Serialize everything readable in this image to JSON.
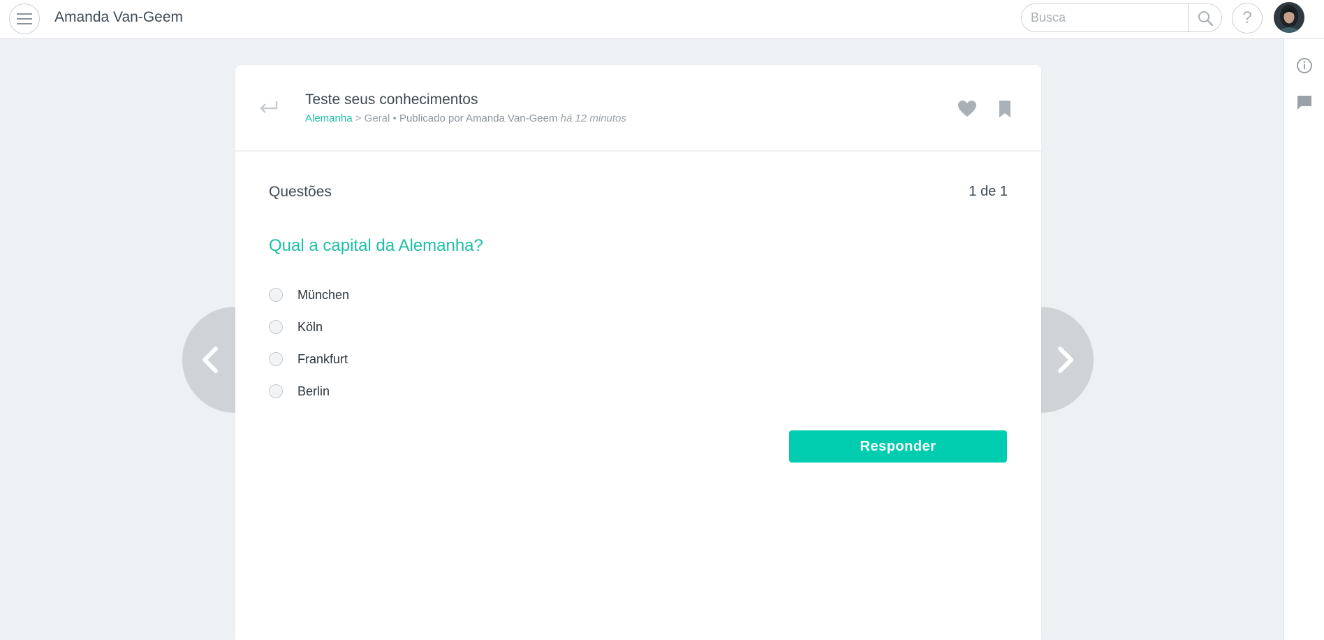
{
  "topbar": {
    "user_name": "Amanda Van-Geem",
    "search_placeholder": "Busca",
    "help_label": "?"
  },
  "post": {
    "title": "Teste seus conhecimentos",
    "breadcrumb": {
      "category": "Alemanha",
      "separator": ">",
      "subcategory": "Geral",
      "bullet": "•",
      "author_text": "Publicado por Amanda Van-Geem",
      "time": "há 12 minutos"
    }
  },
  "quiz": {
    "section_label": "Questões",
    "counter": "1 de 1",
    "question": "Qual a capital da Alemanha?",
    "options": [
      "München",
      "Köln",
      "Frankfurt",
      "Berlin"
    ],
    "answer_button": "Responder"
  },
  "colors": {
    "accent": "#00cdb0",
    "link": "#1bbfa6",
    "background": "#eef1f3",
    "nav_arrow": "#cfd3d8"
  },
  "icons": {
    "menu": "hamburger-icon",
    "search": "magnifier-icon",
    "help": "question-icon",
    "back": "return-arrow-icon",
    "like": "heart-icon",
    "bookmark": "bookmark-icon",
    "info": "info-icon",
    "comments": "chat-bubble-icon",
    "prev": "chevron-left-icon",
    "next": "chevron-right-icon"
  }
}
